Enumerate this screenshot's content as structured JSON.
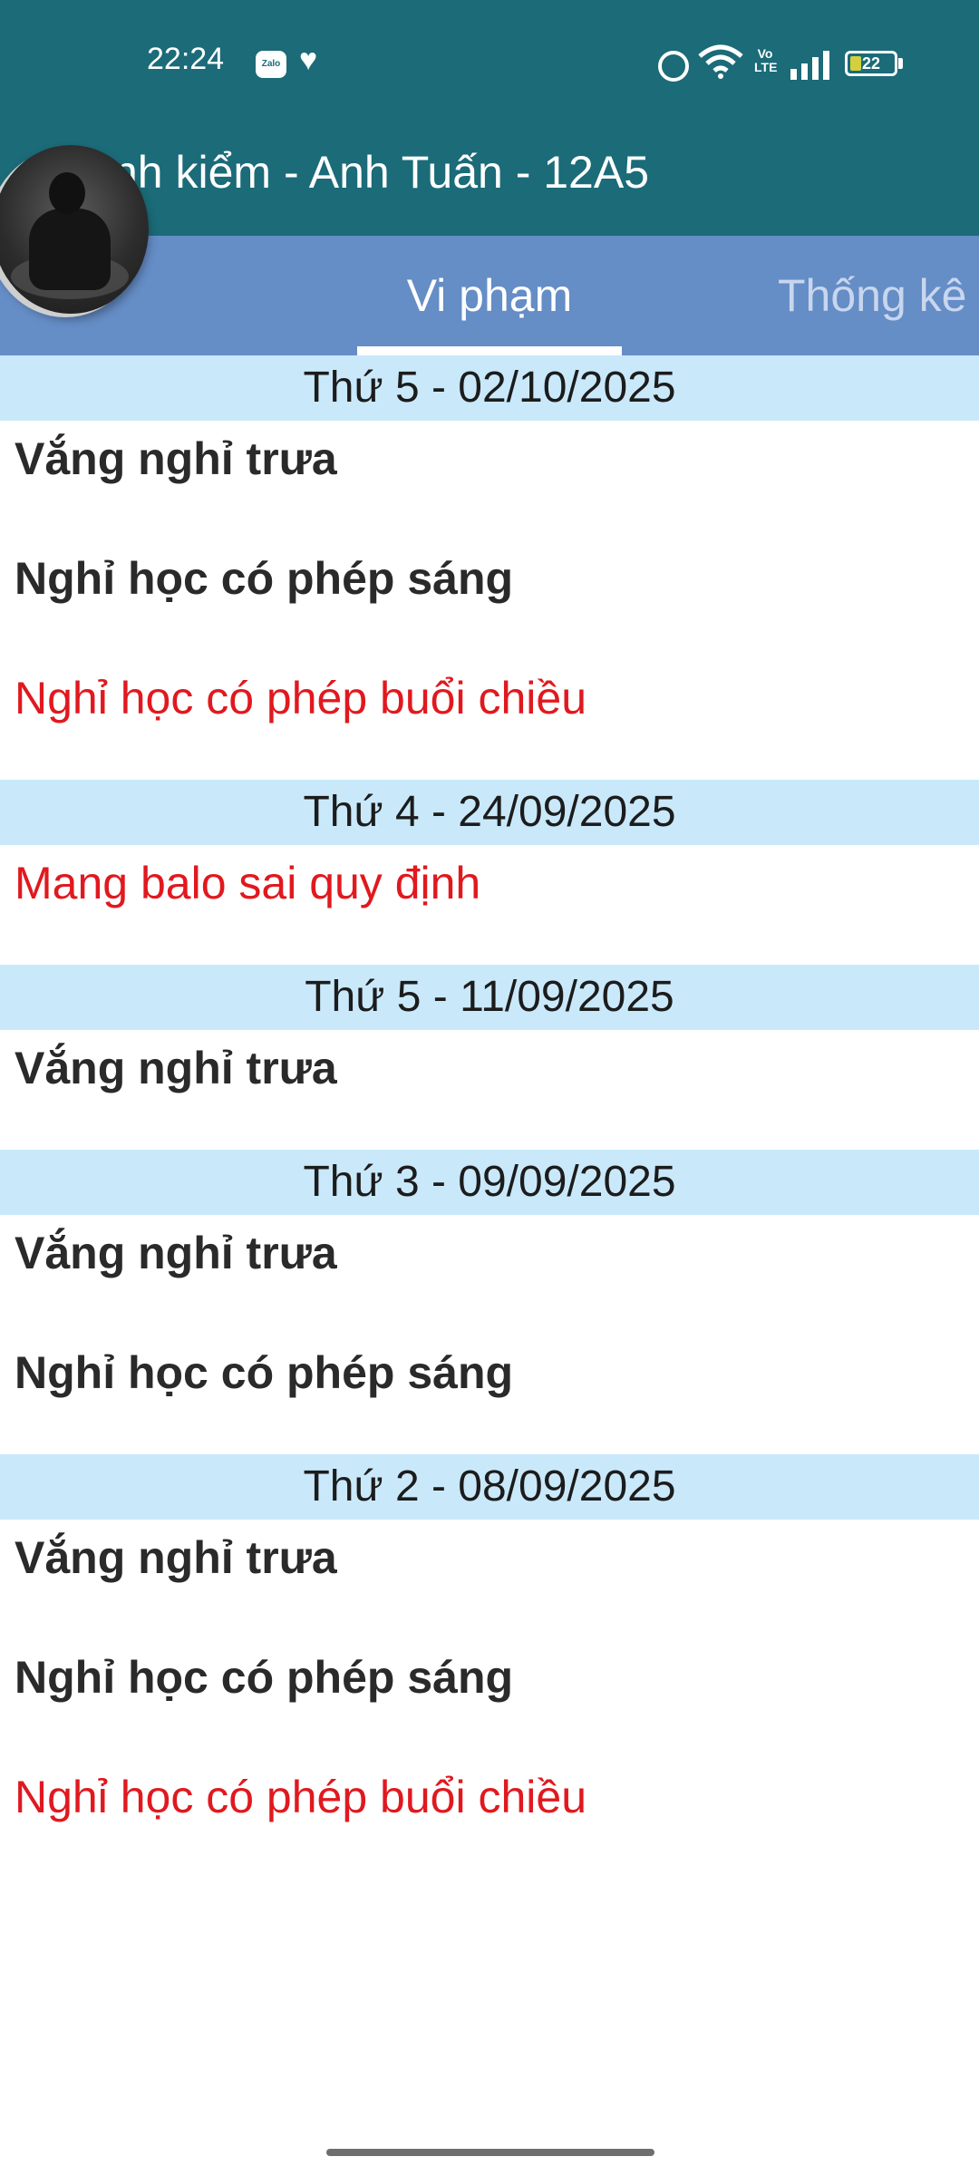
{
  "status_bar": {
    "time": "22:24",
    "zalo_label": "Zalo",
    "volte_label": "Vo\nLTE",
    "battery_level": "22",
    "icons": [
      "zalo-icon",
      "heart-icon",
      "alarm-icon",
      "wifi-icon",
      "volte-icon",
      "signal-icon",
      "battery-icon"
    ]
  },
  "header": {
    "title": "nh kiểm - Anh Tuấn - 12A5",
    "color": "#1b6b78"
  },
  "tabs": [
    {
      "label": "Vi phạm",
      "selected": true
    },
    {
      "label": "Thống kê",
      "selected": false
    }
  ],
  "days": [
    {
      "date": "Thứ 5 - 02/10/2025",
      "items": [
        {
          "text": "Vắng nghỉ trưa",
          "style": "normal"
        },
        {
          "text": "Nghỉ học có phép sáng",
          "style": "normal"
        },
        {
          "text": "Nghỉ học có phép buổi chiều",
          "style": "alert"
        }
      ]
    },
    {
      "date": "Thứ 4 - 24/09/2025",
      "items": [
        {
          "text": "Mang balo sai quy định",
          "style": "alert"
        }
      ]
    },
    {
      "date": "Thứ 5 - 11/09/2025",
      "items": [
        {
          "text": "Vắng nghỉ trưa",
          "style": "normal"
        }
      ]
    },
    {
      "date": "Thứ 3 - 09/09/2025",
      "items": [
        {
          "text": "Vắng nghỉ trưa",
          "style": "normal"
        },
        {
          "text": "Nghỉ học có phép sáng",
          "style": "normal"
        }
      ]
    },
    {
      "date": "Thứ 2 - 08/09/2025",
      "items": [
        {
          "text": "Vắng nghỉ trưa",
          "style": "normal"
        },
        {
          "text": "Nghỉ học có phép sáng",
          "style": "normal"
        },
        {
          "text": "Nghỉ học có phép buổi chiều",
          "style": "alert"
        }
      ]
    }
  ],
  "colors": {
    "tab_bar": "#658dc6",
    "day_header": "#c9e9fb",
    "alert_text": "#e0191f",
    "normal_text": "#2a2a2a"
  }
}
